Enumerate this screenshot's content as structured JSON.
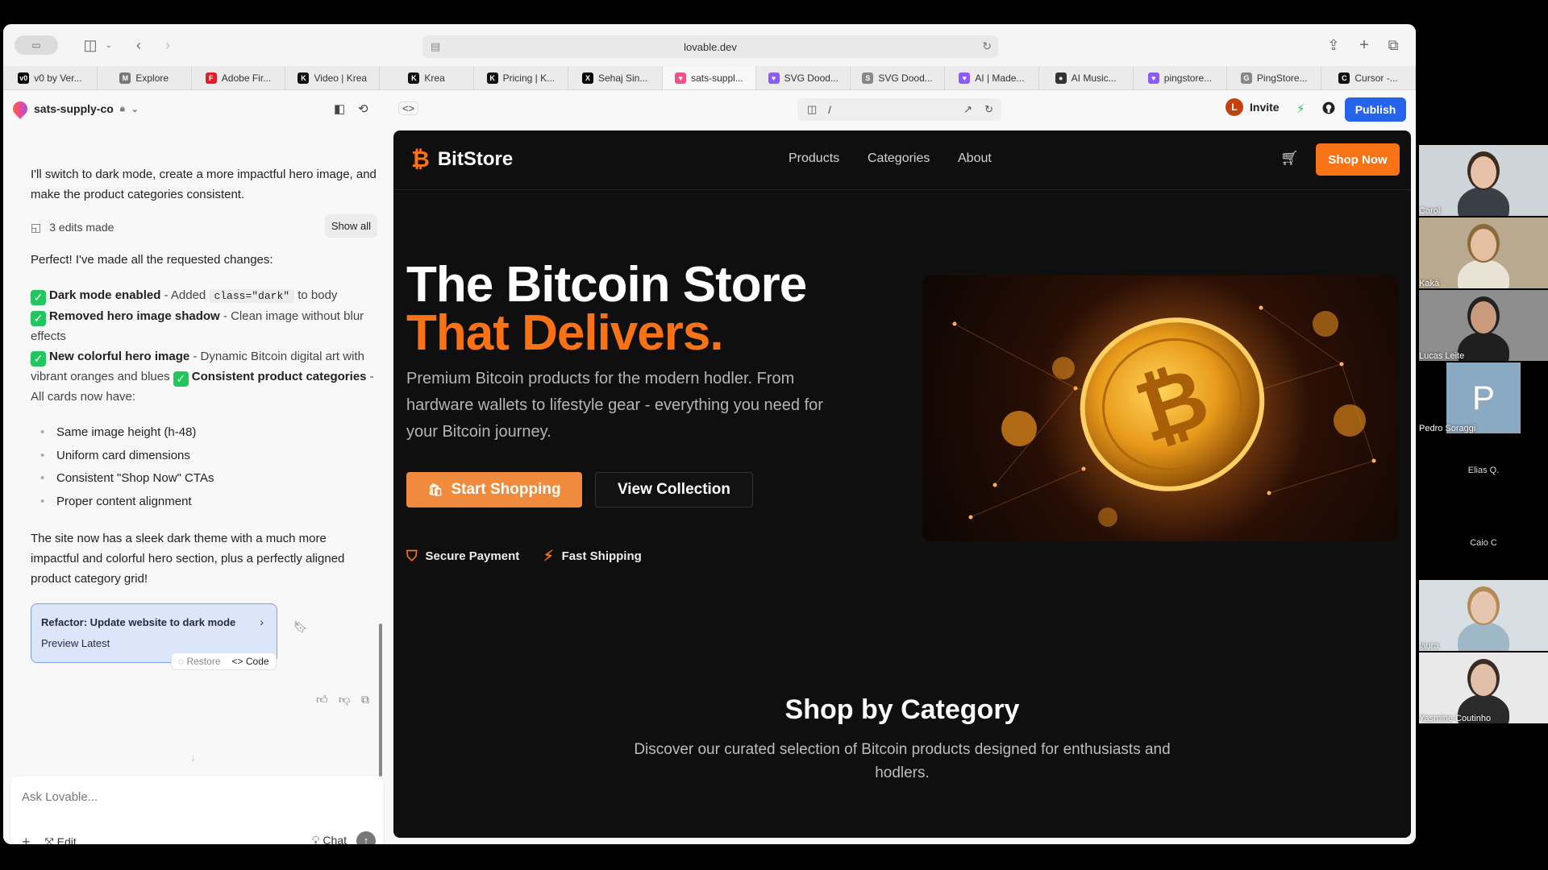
{
  "browser": {
    "url": "lovable.dev",
    "tabs": [
      {
        "label": "v0 by Ver...",
        "fav": "v0",
        "color": "#000000"
      },
      {
        "label": "Explore",
        "fav": "M",
        "color": "#777777"
      },
      {
        "label": "Adobe Fir...",
        "fav": "F",
        "color": "#e11d2a"
      },
      {
        "label": "Video | Krea",
        "fav": "K",
        "color": "#111111"
      },
      {
        "label": "Krea",
        "fav": "K",
        "color": "#111111"
      },
      {
        "label": "Pricing | K...",
        "fav": "K",
        "color": "#111111"
      },
      {
        "label": "Sehaj Sin...",
        "fav": "X",
        "color": "#000000"
      },
      {
        "label": "sats-suppl...",
        "fav": "♥",
        "color": "#f0518a"
      },
      {
        "label": "SVG Dood...",
        "fav": "♥",
        "color": "#8b5cf6"
      },
      {
        "label": "SVG Dood...",
        "fav": "S",
        "color": "#888888"
      },
      {
        "label": "AI | Made...",
        "fav": "♥",
        "color": "#8b5cf6"
      },
      {
        "label": "AI Music...",
        "fav": "●",
        "color": "#333333"
      },
      {
        "label": "pingstore...",
        "fav": "♥",
        "color": "#8b5cf6"
      },
      {
        "label": "PingStore...",
        "fav": "G",
        "color": "#888888"
      },
      {
        "label": "Cursor -...",
        "fav": "C",
        "color": "#111111"
      }
    ],
    "active_tab_index": 7
  },
  "app": {
    "project_name": "sats-supply-co",
    "path": "/",
    "invite_label": "Invite",
    "invite_avatar": "L",
    "publish_label": "Publish"
  },
  "chat": {
    "intro": "I'll switch to dark mode, create a more impactful hero image, and make the product categories consistent.",
    "edits_made": "3 edits made",
    "show_all": "Show all",
    "perfect": "Perfect! I've made all the requested changes:",
    "item1_bold": "Dark mode enabled",
    "item1_text": " - Added ",
    "item1_code": "class=\"dark\"",
    "item1_tail": " to body",
    "item2_bold": "Removed hero image shadow",
    "item2_text": " - Clean image without blur effects",
    "item3_bold": "New colorful hero image",
    "item3_text": " - Dynamic Bitcoin digital art with vibrant oranges and blues ",
    "item4_bold": "Consistent product categories",
    "item4_text": " - All cards now have:",
    "bullets": [
      "Same image height (h-48)",
      "Uniform card dimensions",
      "Consistent \"Shop Now\" CTAs",
      "Proper content alignment"
    ],
    "summary": "The site now has a sleek dark theme with a much more impactful and colorful hero section, plus a perfectly aligned product category grid!",
    "card_title": "Refactor: Update website to dark mode",
    "card_sub": "Preview Latest",
    "restore_label": "Restore",
    "code_label": "Code",
    "input_placeholder": "Ask Lovable...",
    "edit_label": "Edit",
    "chat_label": "Chat"
  },
  "site": {
    "brand": "BitStore",
    "nav": [
      "Products",
      "Categories",
      "About"
    ],
    "shop_now": "Shop Now",
    "hero_line1": "The Bitcoin Store",
    "hero_line2": "That Delivers.",
    "hero_sub": "Premium Bitcoin products for the modern hodler. From hardware wallets to lifestyle gear - everything you need for your Bitcoin journey.",
    "start_shopping": "Start Shopping",
    "view_collection": "View Collection",
    "feature1": "Secure Payment",
    "feature2": "Fast Shipping",
    "section_title": "Shop by Category",
    "section_sub": "Discover our curated selection of Bitcoin products designed for enthusiasts and hodlers."
  },
  "participants": [
    {
      "name": "Carol"
    },
    {
      "name": "Kaká"
    },
    {
      "name": "Lucas Leite"
    },
    {
      "name": "Pedro Soraggi",
      "initial": "P"
    },
    {
      "name": "Elias Q."
    },
    {
      "name": "Caio C"
    },
    {
      "name": "laura"
    },
    {
      "name": "Yasmine Coutinho"
    }
  ],
  "colors": {
    "accent": "#f97316",
    "publish": "#2563eb",
    "check": "#22c55e"
  }
}
